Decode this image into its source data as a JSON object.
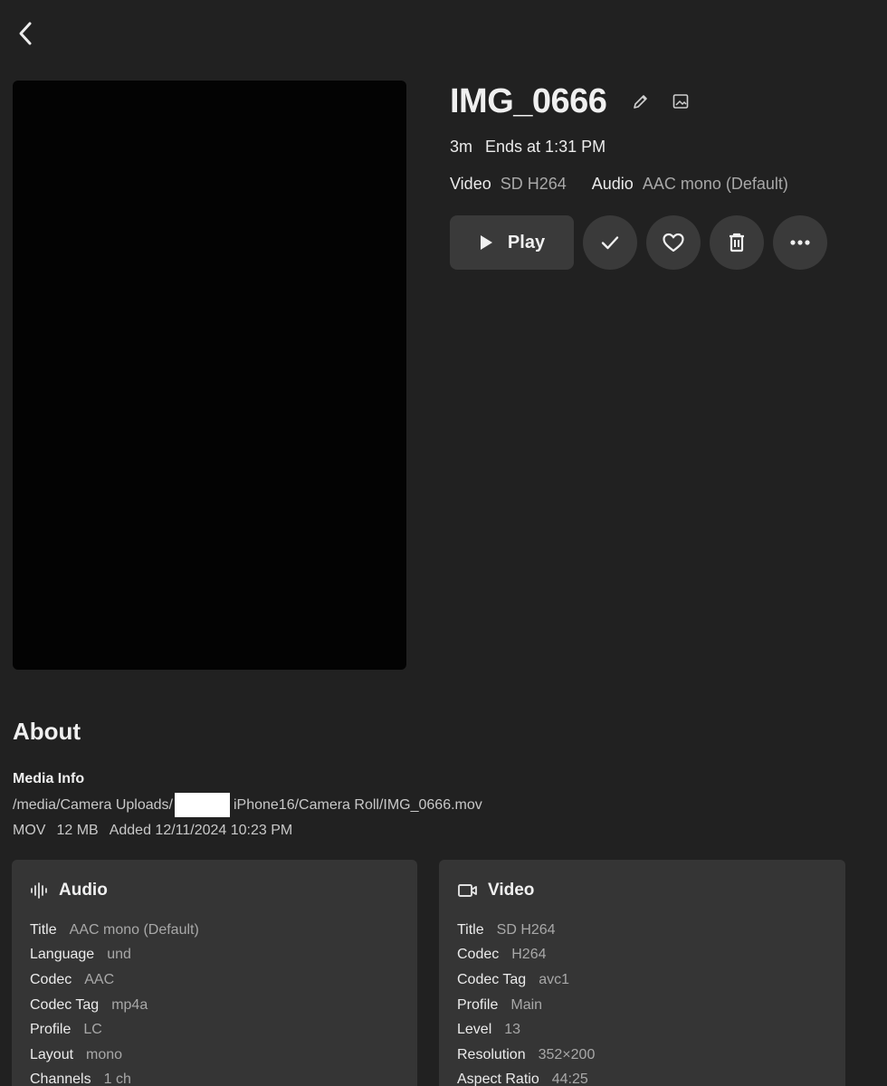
{
  "item": {
    "title": "IMG_0666",
    "runtime": "3m",
    "ends_at": "Ends at 1:31 PM",
    "video_label": "Video",
    "video_value": "SD H264",
    "audio_label": "Audio",
    "audio_value": "AAC mono (Default)"
  },
  "actions": {
    "play_label": "Play",
    "icons": [
      "play-icon",
      "check-icon",
      "heart-icon",
      "trash-icon",
      "more-icon"
    ]
  },
  "about": {
    "heading": "About",
    "media_info_heading": "Media Info",
    "path_start": "/media/Camera Uploads/",
    "path_end": "iPhone16/Camera Roll/IMG_0666.mov",
    "container": "MOV",
    "size": "12 MB",
    "added": "Added 12/11/2024 10:23 PM"
  },
  "audio_card": {
    "title": "Audio",
    "icon": "waveform-icon",
    "rows": [
      {
        "key": "Title",
        "value": "AAC mono (Default)"
      },
      {
        "key": "Language",
        "value": "und"
      },
      {
        "key": "Codec",
        "value": "AAC"
      },
      {
        "key": "Codec Tag",
        "value": "mp4a"
      },
      {
        "key": "Profile",
        "value": "LC"
      },
      {
        "key": "Layout",
        "value": "mono"
      },
      {
        "key": "Channels",
        "value": "1 ch"
      }
    ]
  },
  "video_card": {
    "title": "Video",
    "icon": "video-camera-icon",
    "rows": [
      {
        "key": "Title",
        "value": "SD H264"
      },
      {
        "key": "Codec",
        "value": "H264"
      },
      {
        "key": "Codec Tag",
        "value": "avc1"
      },
      {
        "key": "Profile",
        "value": "Main"
      },
      {
        "key": "Level",
        "value": "13"
      },
      {
        "key": "Resolution",
        "value": "352×200"
      },
      {
        "key": "Aspect Ratio",
        "value": "44:25"
      }
    ]
  },
  "colors": {
    "background": "#212121",
    "card": "#353535",
    "button": "#3a3a3a",
    "text": "#ebebeb",
    "muted": "#a8a8a8"
  }
}
